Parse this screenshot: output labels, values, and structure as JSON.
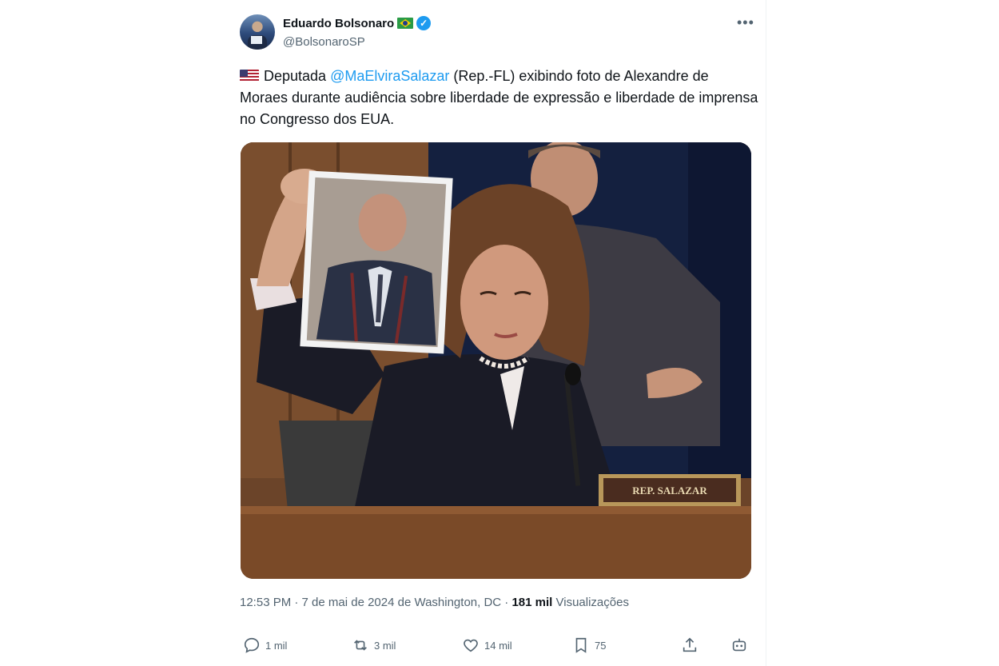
{
  "author": {
    "name": "Eduardo Bolsonaro",
    "handle": "@BolsonaroSP",
    "verified": true
  },
  "tweet": {
    "text_before_mention": "Deputada ",
    "mention": "@MaElviraSalazar",
    "text_after_mention": " (Rep.-FL) exibindo foto de Alexandre de Moraes durante audiência sobre liberdade de expressão e liberdade de imprensa no Congresso dos EUA.",
    "image_placard": "REP. SALAZAR"
  },
  "meta": {
    "time_date": "12:53 PM · 7 de mai de 2024 de Washington, DC · ",
    "views_count": "181 mil",
    "views_label": " Visualizações"
  },
  "actions": {
    "replies": "1 mil",
    "reposts": "3 mil",
    "likes": "14 mil",
    "bookmarks": "75"
  },
  "icons": [
    "brazil-flag-icon",
    "verified-badge-icon",
    "more-options-icon",
    "us-flag-icon",
    "reply-icon",
    "repost-icon",
    "like-icon",
    "bookmark-icon",
    "share-icon",
    "grok-icon"
  ],
  "colors": {
    "accent": "#1d9bf0",
    "text": "#0f1419",
    "secondary": "#536471"
  }
}
